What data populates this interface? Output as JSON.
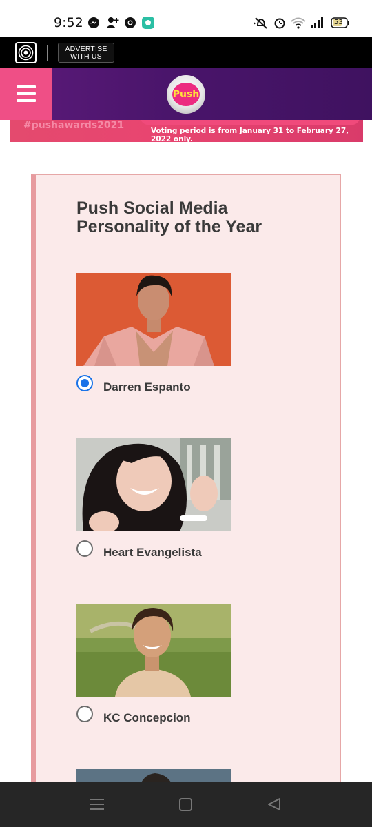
{
  "status_bar": {
    "time": "9:52",
    "battery": "53",
    "left_icons": [
      "messenger-icon",
      "add-contact-icon",
      "chrome-icon",
      "app-notification-icon"
    ],
    "right_icons": [
      "vibrate-mute-icon",
      "alarm-icon",
      "wifi-icon",
      "signal-icon",
      "battery-icon"
    ]
  },
  "site_bar": {
    "logo": "abs-cbn-logo",
    "advertise_line1": "ADVERTISE",
    "advertise_line2": "WITH US"
  },
  "header": {
    "logo_text": "Push",
    "menu_icon": "hamburger-menu-icon",
    "brand_color": "#ef4f86"
  },
  "banner": {
    "hashtag": "#pushawards2021",
    "voting_text": "Voting period is from January 31 to February 27, 2022 only."
  },
  "poll": {
    "title": "Push Social Media Personality of the Year",
    "candidates": [
      {
        "name": "Darren Espanto",
        "selected": true
      },
      {
        "name": "Heart Evangelista",
        "selected": false
      },
      {
        "name": "KC Concepcion",
        "selected": false
      }
    ]
  },
  "nav_bar": {
    "icons": [
      "recent-apps-icon",
      "home-icon",
      "back-icon"
    ]
  },
  "colors": {
    "card_background": "#fbeaea",
    "card_accent": "#e79b9f",
    "radio_selected": "#1a73e8"
  }
}
